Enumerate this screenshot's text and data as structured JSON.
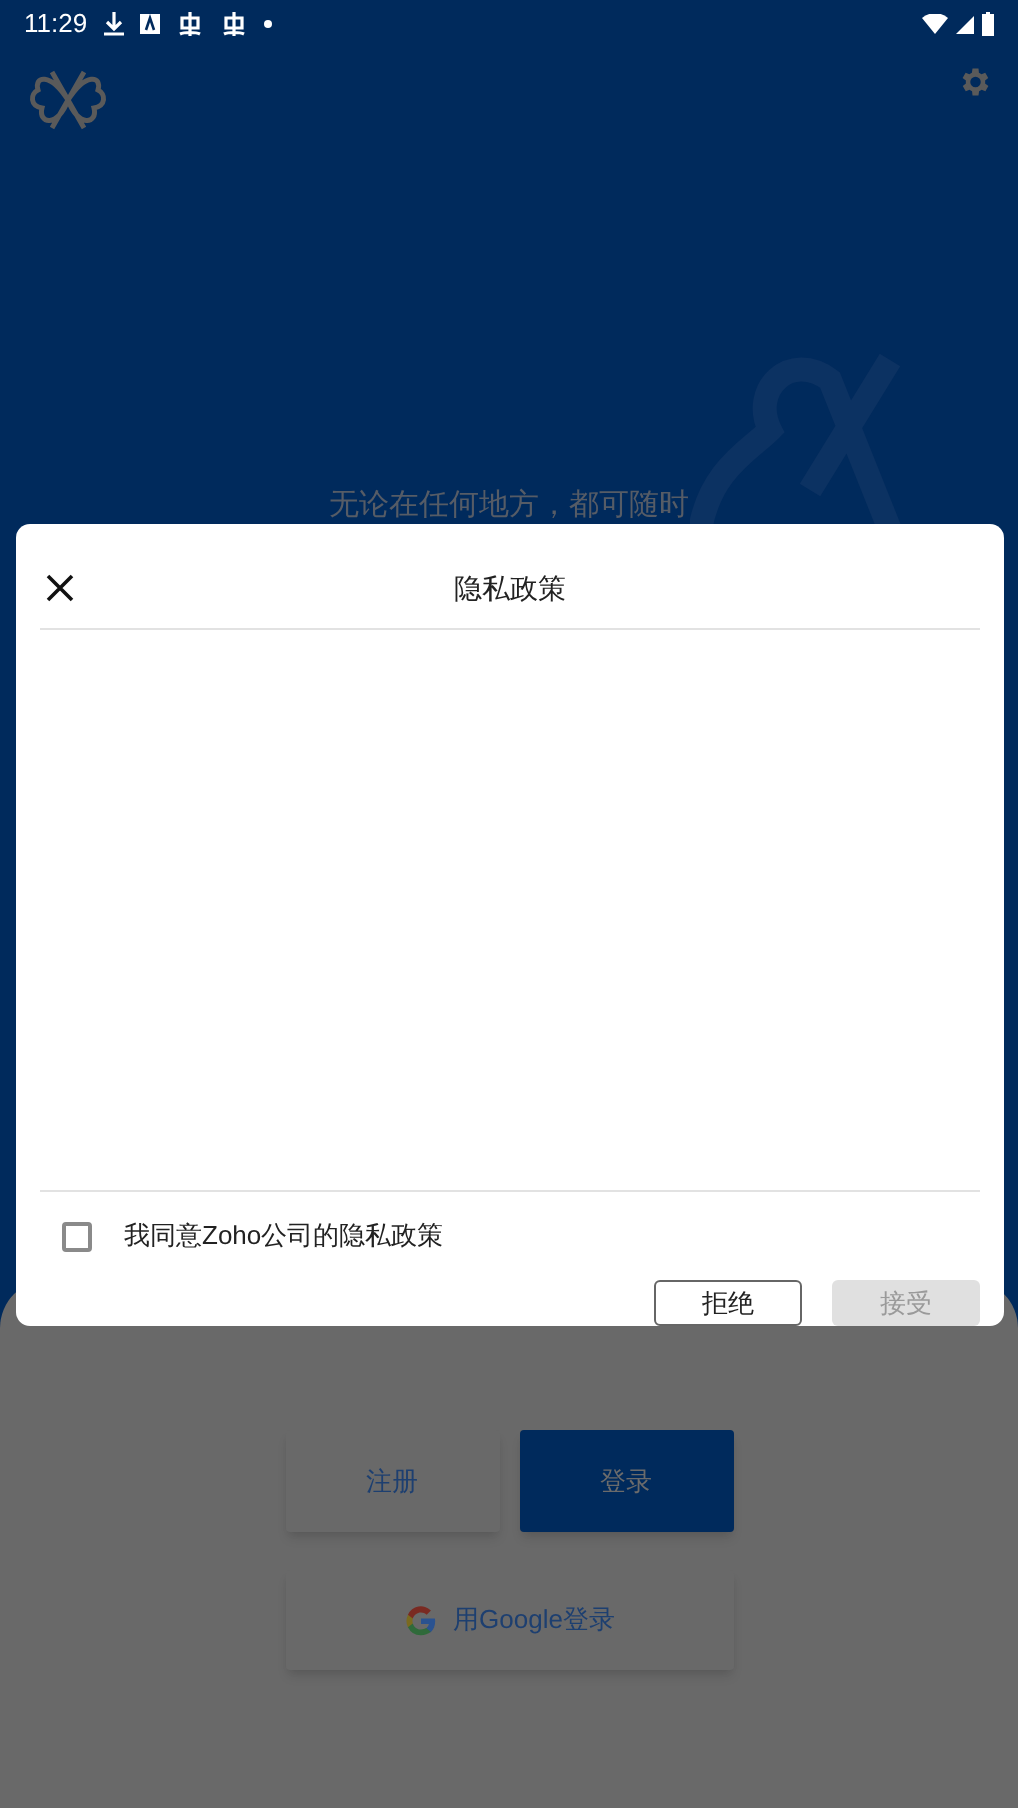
{
  "status_bar": {
    "time": "11:29"
  },
  "background": {
    "tagline": "无论在任何地方，都可随时",
    "buttons": [
      {
        "label": "注册",
        "kind": "outline"
      },
      {
        "label": "登录",
        "kind": "primary"
      }
    ],
    "google_button": {
      "label": "用Google登录"
    }
  },
  "dialog": {
    "title": "隐私政策",
    "consent": {
      "label": "我同意Zoho公司的隐私政策",
      "checked": false
    },
    "buttons": [
      {
        "label": "拒绝",
        "disabled": false
      },
      {
        "label": "接受",
        "disabled": true
      }
    ]
  }
}
